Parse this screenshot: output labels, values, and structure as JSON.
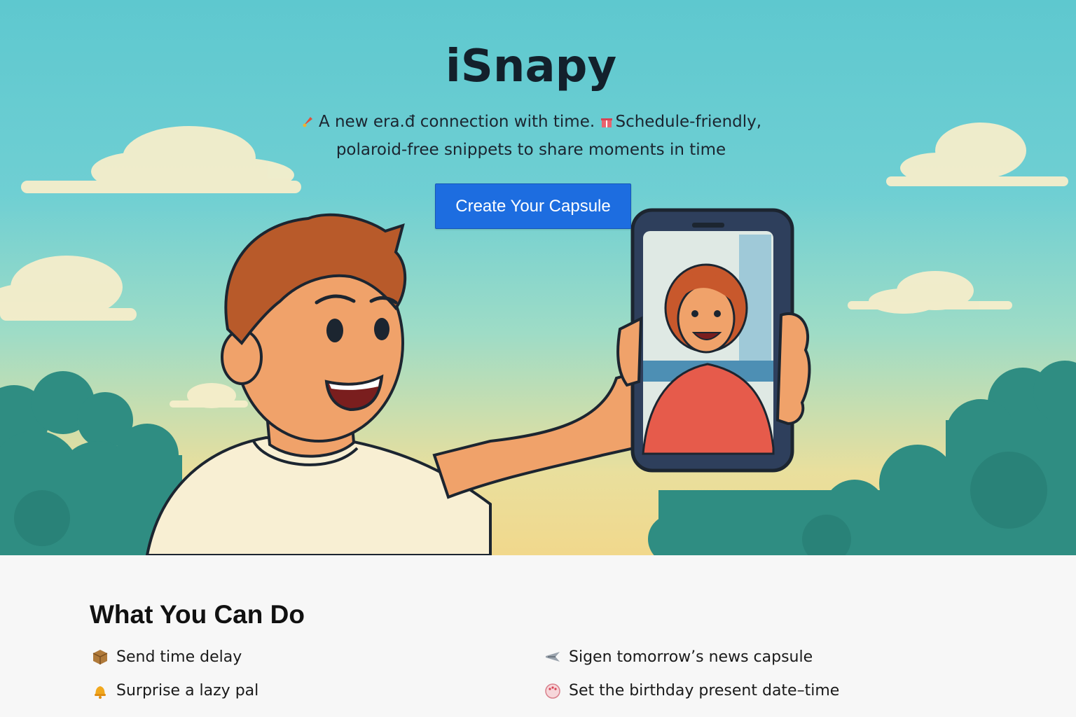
{
  "hero": {
    "title": "iSnapy",
    "subtitle_line1": "A new era.đ connection with time. ",
    "subtitle_line1b": "Schedule-friendly,",
    "subtitle_line2": "polaroid-free snippets to share moments in time",
    "cta_label": "Create Your Capsule",
    "icons": [
      "rocket-icon",
      "gift-icon"
    ]
  },
  "features": {
    "heading": "What You Can Do",
    "items": [
      {
        "label": "Send time delay",
        "icon": "package-icon"
      },
      {
        "label": "Surprise a lazy pal",
        "icon": "bell-icon"
      },
      {
        "label": "Sigen tomorrow’s news capsule",
        "icon": "airplane-icon"
      },
      {
        "label": "Set the birthday present date–time",
        "icon": "cake-icon"
      }
    ]
  },
  "colors": {
    "cta_bg": "#1d6de0",
    "sky_top": "#5ec8cf",
    "sky_bottom": "#f1d88c",
    "foliage": "#2d8c80"
  }
}
